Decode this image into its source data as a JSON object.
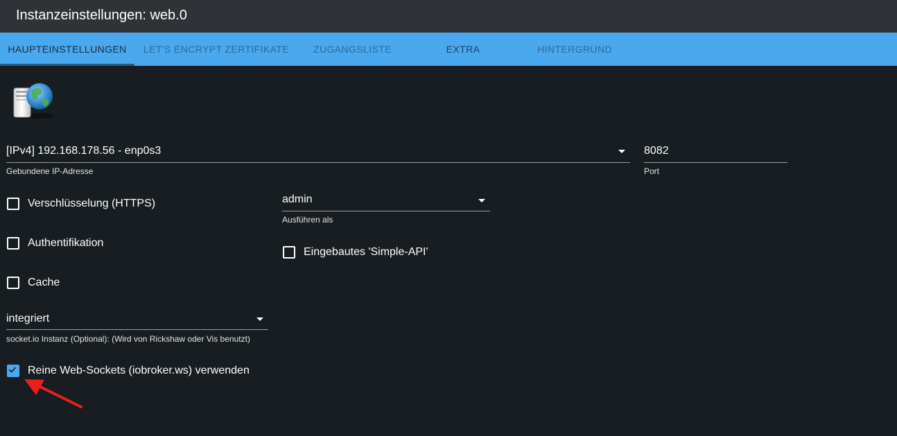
{
  "window": {
    "title": "Instanzeinstellungen: web.0"
  },
  "tabs": [
    {
      "label": "HAUPTEINSTELLUNGEN"
    },
    {
      "label": "LET'S ENCRYPT ZERTIFIKATE"
    },
    {
      "label": "ZUGANGSLISTE"
    },
    {
      "label": "EXTRA"
    },
    {
      "label": "HINTERGRUND"
    }
  ],
  "main": {
    "ip_select": {
      "value": "[IPv4] 192.168.178.56 - enp0s3",
      "helper": "Gebundene IP-Adresse"
    },
    "port_input": {
      "value": "8082",
      "helper": "Port"
    },
    "https_checkbox": {
      "label": "Verschlüsselung (HTTPS)",
      "checked": false
    },
    "auth_checkbox": {
      "label": "Authentifikation",
      "checked": false
    },
    "cache_checkbox": {
      "label": "Cache",
      "checked": false
    },
    "run_as_select": {
      "value": "admin",
      "helper": "Ausführen als"
    },
    "simple_api_checkbox": {
      "label": "Eingebautes 'Simple-API'",
      "checked": false
    },
    "socketio_select": {
      "value": "integriert",
      "helper": "socket.io Instanz (Optional): (Wird von Rickshaw oder Vis benutzt)"
    },
    "websockets_checkbox": {
      "label": "Reine Web-Sockets (iobroker.ws) verwenden",
      "checked": true
    }
  },
  "colors": {
    "accent": "#4aa8ef",
    "background": "#171d20",
    "titlebar": "#2f3236",
    "annotation_arrow": "#e8201c"
  },
  "icons": {
    "logo": "server-globe-icon",
    "dropdown": "caret-down-icon",
    "check": "check-icon",
    "annotation": "red-arrow-icon"
  }
}
